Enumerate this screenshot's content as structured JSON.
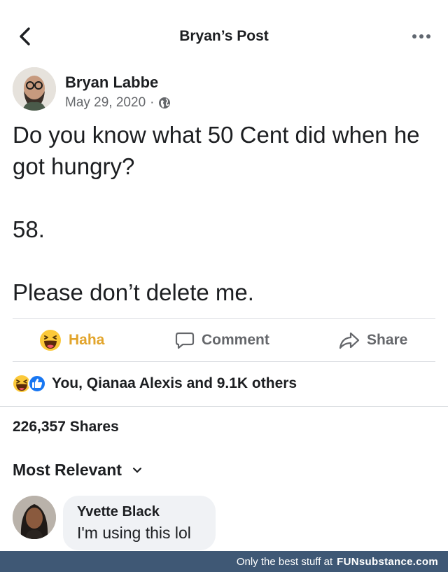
{
  "header": {
    "title": "Bryan’s Post",
    "back_icon": "chevron-left-icon",
    "more_icon": "more-horizontal-icon"
  },
  "post": {
    "author": "Bryan Labbe",
    "date": "May 29, 2020",
    "separator": "·",
    "privacy_icon": "globe-icon",
    "lines": [
      "Do you know what 50 Cent did when he got hungry?",
      "58.",
      "Please don’t delete me."
    ]
  },
  "actions": {
    "haha": "Haha",
    "comment": "Comment",
    "share": "Share",
    "haha_color": "#e2a42b"
  },
  "reactions": {
    "summary": "You, Qianaa Alexis and 9.1K others",
    "icons": [
      "haha-reaction-icon",
      "like-reaction-icon"
    ]
  },
  "shares": {
    "text": "226,357 Shares"
  },
  "comments": {
    "sort_label": "Most Relevant",
    "items": [
      {
        "author": "Yvette Black",
        "text": "I'm using this lol"
      }
    ]
  },
  "watermark": {
    "text": "Only the best stuff at",
    "brand": "FUNsubstance.com"
  },
  "colors": {
    "text": "#1c1e21",
    "secondary": "#65676b",
    "like_blue": "#1877f2",
    "bubble": "#f0f2f5",
    "footer": "#3f5875"
  }
}
